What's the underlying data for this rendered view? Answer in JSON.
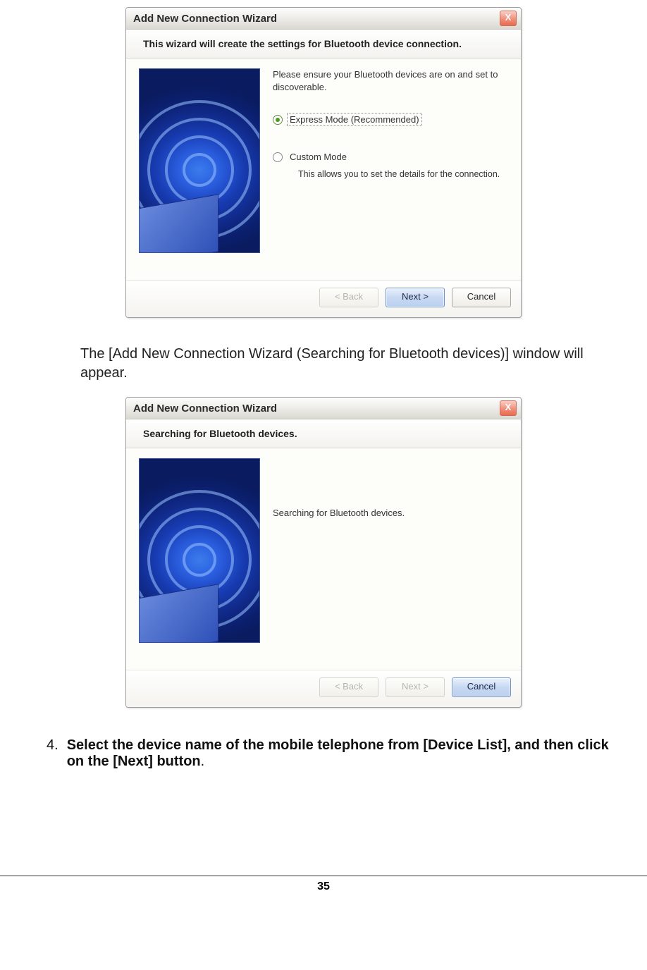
{
  "dialog1": {
    "title": "Add New Connection Wizard",
    "header": "This wizard will create the settings for Bluetooth device connection.",
    "instruction": "Please ensure your Bluetooth devices are on and set to discoverable.",
    "option_express": "Express Mode (Recommended)",
    "option_custom": "Custom Mode",
    "custom_note": "This allows you to set the details for the connection.",
    "back": "< Back",
    "next": "Next >",
    "cancel": "Cancel"
  },
  "para1": "The [Add New Connection Wizard (Searching for Bluetooth devices)] window will appear.",
  "dialog2": {
    "title": "Add New Connection Wizard",
    "header": "Searching for Bluetooth devices.",
    "message": "Searching for Bluetooth devices.",
    "back": "< Back",
    "next": "Next >",
    "cancel": "Cancel"
  },
  "step4": {
    "num": "4.",
    "text": "Select the device name of the mobile telephone from [Device List], and then click on the [Next] button",
    "period": "."
  },
  "page_number": "35"
}
